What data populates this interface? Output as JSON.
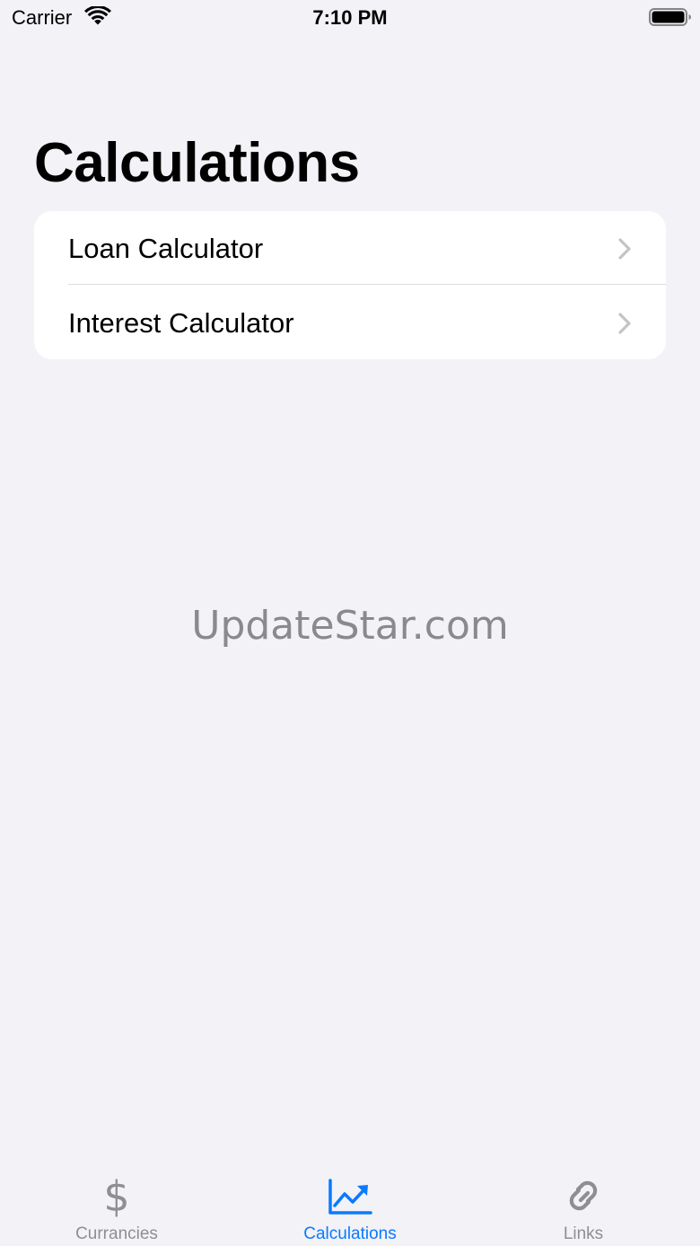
{
  "status_bar": {
    "carrier": "Carrier",
    "time": "7:10 PM"
  },
  "header": {
    "title": "Calculations"
  },
  "list": {
    "items": [
      {
        "label": "Loan Calculator",
        "icon": "chevron-right-icon"
      },
      {
        "label": "Interest Calculator",
        "icon": "chevron-right-icon"
      }
    ]
  },
  "watermark": "UpdateStar.com",
  "tab_bar": {
    "tabs": [
      {
        "label": "Currancies",
        "icon": "dollar-sign-icon",
        "active": false
      },
      {
        "label": "Calculations",
        "icon": "chart-line-uptrend-icon",
        "active": true
      },
      {
        "label": "Links",
        "icon": "link-icon",
        "active": false
      }
    ]
  },
  "colors": {
    "background": "#f2f2f7",
    "accent": "#0a7aff",
    "inactive": "#8e8e93",
    "chevron": "#c4c4c7"
  }
}
